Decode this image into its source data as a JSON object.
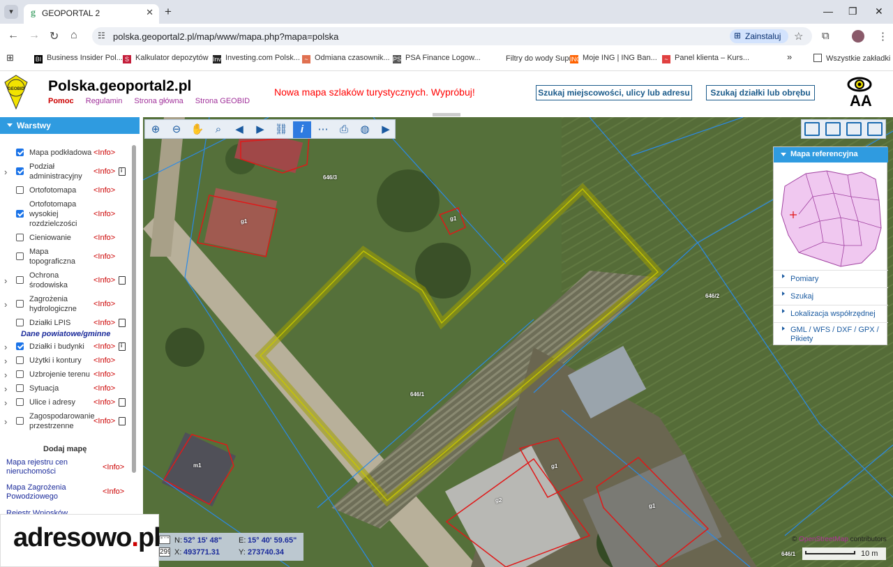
{
  "browser": {
    "tab_title": "GEOPORTAL 2",
    "url": "polska.geoportal2.pl/map/www/mapa.php?mapa=polska",
    "install_label": "Zainstaluj",
    "bookmarks": [
      {
        "label": "Business Insider Pol...",
        "icon": "BI",
        "color": "#000000"
      },
      {
        "label": "Kalkulator depozytów",
        "icon": "S",
        "color": "#c41e3a"
      },
      {
        "label": "Investing.com Polsk...",
        "icon": "Inv",
        "color": "#222222"
      },
      {
        "label": "Odmiana czasownik...",
        "icon": "~",
        "color": "#e07050"
      },
      {
        "label": "PSA Finance Logow...",
        "icon": "PSA",
        "color": "#555555"
      },
      {
        "label": "Filtry do wody Supr...",
        "icon": "",
        "color": "#ffffff"
      },
      {
        "label": "Moje ING | ING Ban...",
        "icon": "ING",
        "color": "#ff6200"
      },
      {
        "label": "Panel klienta – Kurs...",
        "icon": "~",
        "color": "#e04040"
      }
    ],
    "all_bookmarks_label": "Wszystkie zakładki"
  },
  "header": {
    "title": "Polska.geoportal2.pl",
    "logo_text": "GEOBID",
    "links": [
      "Pomoc",
      "Regulamin",
      "Strona główna",
      "Strona GEOBID"
    ],
    "promo": "Nowa mapa szlaków turystycznych. Wypróbuj!",
    "search_address_button": "Szukaj miejscowości, ulicy lub adresu",
    "search_parcel_button": "Szukaj działki lub obrębu",
    "font_size_label": "AA"
  },
  "sidebar": {
    "title": "Warstwy",
    "layers": [
      {
        "name": "Mapa podkładowa",
        "checked": true,
        "expand": false,
        "doc": ""
      },
      {
        "name": "Podział administracyjny",
        "checked": true,
        "expand": true,
        "doc": "meta"
      },
      {
        "name": "Ortofotomapa",
        "checked": false,
        "expand": false,
        "doc": ""
      },
      {
        "name": "Ortofotomapa wysokiej rozdzielczości",
        "checked": true,
        "expand": false,
        "doc": ""
      },
      {
        "name": "Cieniowanie",
        "checked": false,
        "expand": false,
        "doc": ""
      },
      {
        "name": "Mapa topograficzna",
        "checked": false,
        "expand": false,
        "doc": ""
      },
      {
        "name": "Ochrona środowiska",
        "checked": false,
        "expand": true,
        "doc": "doc"
      },
      {
        "name": "Zagrożenia hydrologiczne",
        "checked": false,
        "expand": true,
        "doc": ""
      },
      {
        "name": "Działki LPIS",
        "checked": false,
        "expand": false,
        "doc": "doc"
      },
      {
        "name": "Działki i budynki",
        "checked": true,
        "expand": true,
        "doc": "meta"
      },
      {
        "name": "Użytki i kontury",
        "checked": false,
        "expand": true,
        "doc": ""
      },
      {
        "name": "Uzbrojenie terenu",
        "checked": false,
        "expand": true,
        "doc": ""
      },
      {
        "name": "Sytuacja",
        "checked": false,
        "expand": true,
        "doc": ""
      },
      {
        "name": "Ulice i adresy",
        "checked": false,
        "expand": true,
        "doc": "doc"
      },
      {
        "name": "Zagospodarowanie przestrzenne",
        "checked": false,
        "expand": true,
        "doc": "doc"
      }
    ],
    "info_label": "<Info>",
    "group_label": "Dane powiatowe/gminne",
    "add_map_label": "Dodaj mapę",
    "add_maps": [
      {
        "name": "Mapa rejestru cen nieruchomości"
      },
      {
        "name": "Mapa Zagrożenia Powodziowego"
      },
      {
        "name": "Rejestr Wniosków Decyzji i"
      }
    ]
  },
  "reference_panel": {
    "title": "Mapa referencyjna",
    "items": [
      "Pomiary",
      "Szukaj",
      "Lokalizacja współrzędnej",
      "GML / WFS / DXF / GPX / Pikiety"
    ]
  },
  "coords": {
    "format_label": "° ' \"",
    "code": "2992",
    "n_label": "N:",
    "n_value": "52° 15' 48\"",
    "e_label": "E:",
    "e_value": "15° 40' 59.65\"",
    "x_label": "X:",
    "x_value": "493771.31",
    "y_label": "Y:",
    "y_value": "273740.34"
  },
  "map": {
    "parcel_labels": [
      "646/3",
      "646/1",
      "646/2",
      "646/1"
    ],
    "building_labels": [
      "g1",
      "g1",
      "m1",
      "g1",
      "g2",
      "g1"
    ],
    "attribution_prefix": "©",
    "attribution_link": "OpenStreetMap",
    "attribution_suffix": "contributors",
    "scale_label": "10 m"
  },
  "watermark": {
    "text_a": "adresowo",
    "dot": ".",
    "text_b": "pl"
  }
}
